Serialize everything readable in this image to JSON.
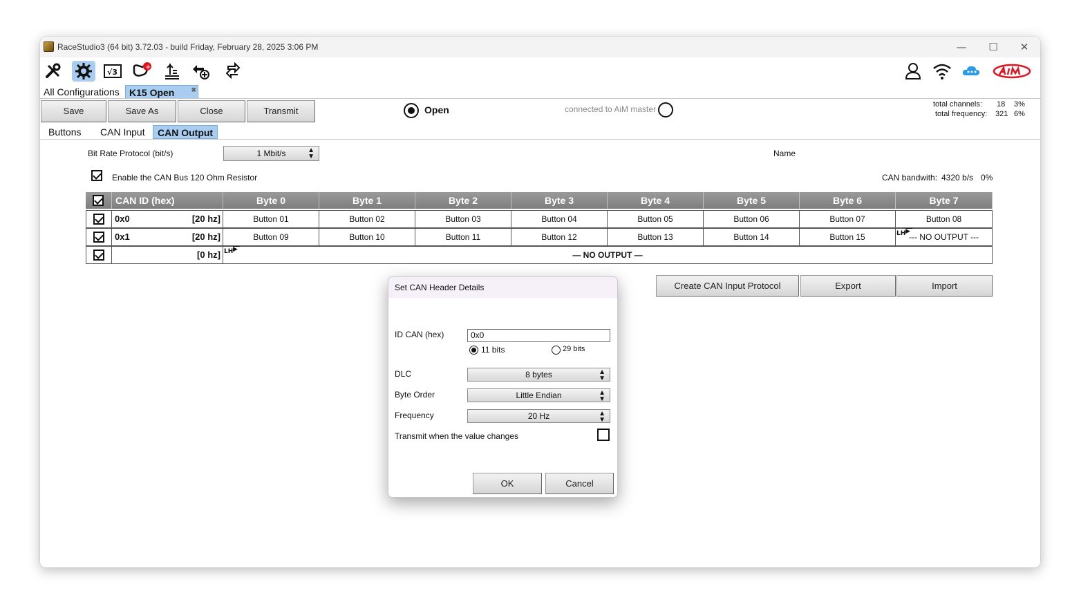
{
  "window": {
    "title": "RaceStudio3 (64 bit) 3.72.03 - build Friday, February 28, 2025 3:06 PM",
    "controls": {
      "minimize": "—",
      "maximize": "☐",
      "close": "✕"
    }
  },
  "toolbar": {
    "icons": [
      "tools-icon",
      "device-config-icon",
      "math-channels-icon",
      "tracks-icon",
      "data-download-icon",
      "add-device-icon",
      "sync-icon"
    ],
    "right_icons": [
      "user-icon",
      "wifi-icon",
      "cloud-icon",
      "aim-logo"
    ]
  },
  "config_tabs": {
    "all": "All Configurations",
    "active": "K15 Open",
    "close_glyph": "✖"
  },
  "actions": {
    "save": "Save",
    "save_as": "Save As",
    "close": "Close",
    "transmit": "Transmit"
  },
  "status": {
    "mode_label": "Open",
    "connection": "connected to AiM master",
    "total_channels_label": "total channels:",
    "total_channels_value": "18",
    "total_channels_pct": "3%",
    "total_frequency_label": "total frequency:",
    "total_frequency_value": "321",
    "total_frequency_pct": "6%"
  },
  "sub_tabs": [
    "Buttons",
    "CAN Input",
    "CAN Output"
  ],
  "can_output": {
    "bit_rate_label": "Bit Rate Protocol (bit/s)",
    "bit_rate_value": "1  Mbit/s",
    "name_label": "Name",
    "resistor_label": "Enable the CAN Bus 120 Ohm Resistor",
    "resistor_enabled": true,
    "bandwidth_label": "CAN bandwith:",
    "bandwidth_value": "4320 b/s",
    "bandwidth_pct": "0%",
    "table": {
      "headers": [
        "CAN ID (hex)",
        "Byte 0",
        "Byte 1",
        "Byte 2",
        "Byte 3",
        "Byte 4",
        "Byte 5",
        "Byte 6",
        "Byte 7"
      ],
      "rows": [
        {
          "id": "0x0",
          "freq": "[20 hz]",
          "bytes": [
            "Button 01",
            "Button 02",
            "Button 03",
            "Button 04",
            "Button 05",
            "Button 06",
            "Button 07",
            "Button 08"
          ]
        },
        {
          "id": "0x1",
          "freq": "[20 hz]",
          "bytes": [
            "Button 09",
            "Button 10",
            "Button 11",
            "Button 12",
            "Button 13",
            "Button 14",
            "Button 15",
            "--- NO OUTPUT ---"
          ]
        },
        {
          "id": "",
          "freq": "[0 hz]",
          "span": "— NO OUTPUT —"
        }
      ],
      "lh_marker": "LH"
    },
    "buttons": {
      "create": "Create CAN Input Protocol",
      "export": "Export",
      "import": "Import"
    }
  },
  "dialog": {
    "title": "Set CAN Header Details",
    "id_label": "ID CAN (hex)",
    "id_value": "0x0",
    "bits_11": "11 bits",
    "bits_29": "29 bits",
    "dlc_label": "DLC",
    "dlc_value": "8 bytes",
    "byte_order_label": "Byte Order",
    "byte_order_value": "Little Endian",
    "frequency_label": "Frequency",
    "frequency_value": "20 Hz",
    "transmit_label": "Transmit when the value changes",
    "transmit_checked": false,
    "ok": "OK",
    "cancel": "Cancel"
  }
}
